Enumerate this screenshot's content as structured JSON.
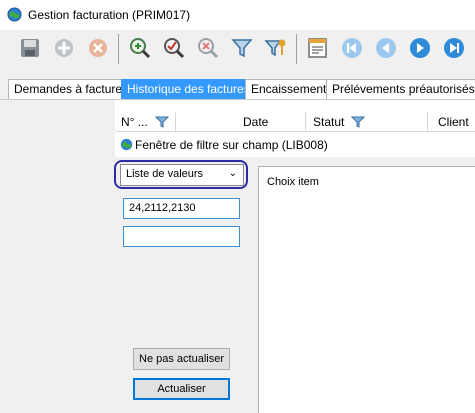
{
  "window": {
    "title": "Gestion facturation (PRIM017)"
  },
  "toolbar": {
    "buttons": [
      "save-icon",
      "add-icon",
      "cancel-icon",
      "zoom-in-icon",
      "zoom-check-icon",
      "zoom-out-icon",
      "filter-icon",
      "filter-key-icon",
      "report-icon",
      "first-icon",
      "prev-icon",
      "next-icon",
      "last-icon"
    ]
  },
  "tabs": [
    {
      "label": "Demandes à facturer",
      "active": false
    },
    {
      "label": "Historique des factures",
      "active": true
    },
    {
      "label": "Encaissements",
      "active": false
    },
    {
      "label": "Prélévements préautorisés",
      "active": false
    }
  ],
  "grid": {
    "columns": [
      "N° ...",
      "Date",
      "Statut",
      "Client"
    ]
  },
  "filter_window": {
    "title": "Fenêtre de filtre sur champ (LIB008)",
    "mode_select": {
      "value": "Liste de valeurs"
    },
    "value_input": {
      "value": "24,2112,2130"
    },
    "second_input": {
      "value": ""
    },
    "list_header": "Choix item",
    "buttons": {
      "no_update": "Ne pas actualiser",
      "update": "Actualiser"
    }
  },
  "colors": {
    "active_tab": "#3399ff",
    "highlight_ring": "#2c2ca6",
    "toolbar_bg": "#f0f0f0"
  }
}
